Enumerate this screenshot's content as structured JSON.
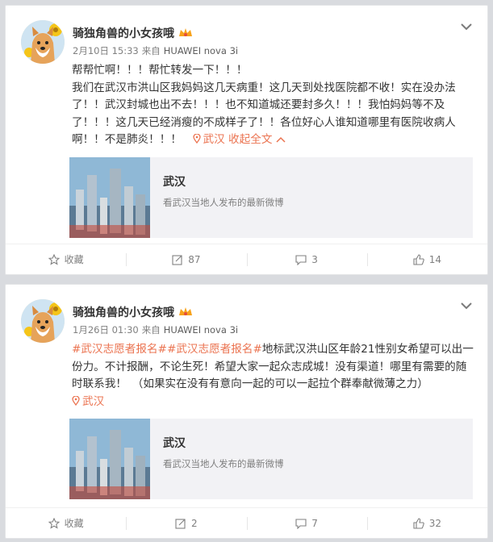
{
  "posts": [
    {
      "username": "骑独角兽的小女孩哦",
      "date": "2月10日 15:33",
      "via_label": "来自",
      "client": "HUAWEI nova 3i",
      "lines": [
        "帮帮忙啊！！！帮忙转发一下！！！",
        "我们在武汉市洪山区我妈妈这几天病重！这几天到处找医院都不收！实在没办法了！！武汉封城也出不去！！！也不知道城还要封多久！！！我怕妈妈等不及了！！！这几天已经消瘦的不成样子了！！各位好心人谁知道哪里有医院收病人啊！！不是肺炎！！！"
      ],
      "location": "武汉",
      "collapse_label": "收起全文",
      "link_card": {
        "title": "武汉",
        "desc": "看武汉当地人发布的最新微博"
      },
      "actions": {
        "favorite": "收藏",
        "repost": "87",
        "comment": "3",
        "like": "14"
      }
    },
    {
      "username": "骑独角兽的小女孩哦",
      "date": "1月26日 01:30",
      "via_label": "来自",
      "client": "HUAWEI nova 3i",
      "tag1": "#武汉志愿者报名#",
      "tag2": "#武汉志愿者报名#",
      "body": "地标武汉洪山区年龄21性别女希望可以出一份力。不计报酬，不论生死！希望大家一起众志成城！没有渠道！哪里有需要的随时联系我！　（如果实在没有有意向一起的可以一起拉个群奉献微薄之力）",
      "location": "武汉",
      "link_card": {
        "title": "武汉",
        "desc": "看武汉当地人发布的最新微博"
      },
      "actions": {
        "favorite": "收藏",
        "repost": "2",
        "comment": "7",
        "like": "32"
      }
    }
  ],
  "colors": {
    "accent": "#eb7350",
    "muted": "#808080",
    "background": "#d9dbdf"
  },
  "icons": [
    "avatar-shiba",
    "chevron-down-icon",
    "vip-crown-icon",
    "location-pin-icon",
    "collapse-up-icon",
    "star-icon",
    "repost-icon",
    "comment-icon",
    "like-icon"
  ]
}
